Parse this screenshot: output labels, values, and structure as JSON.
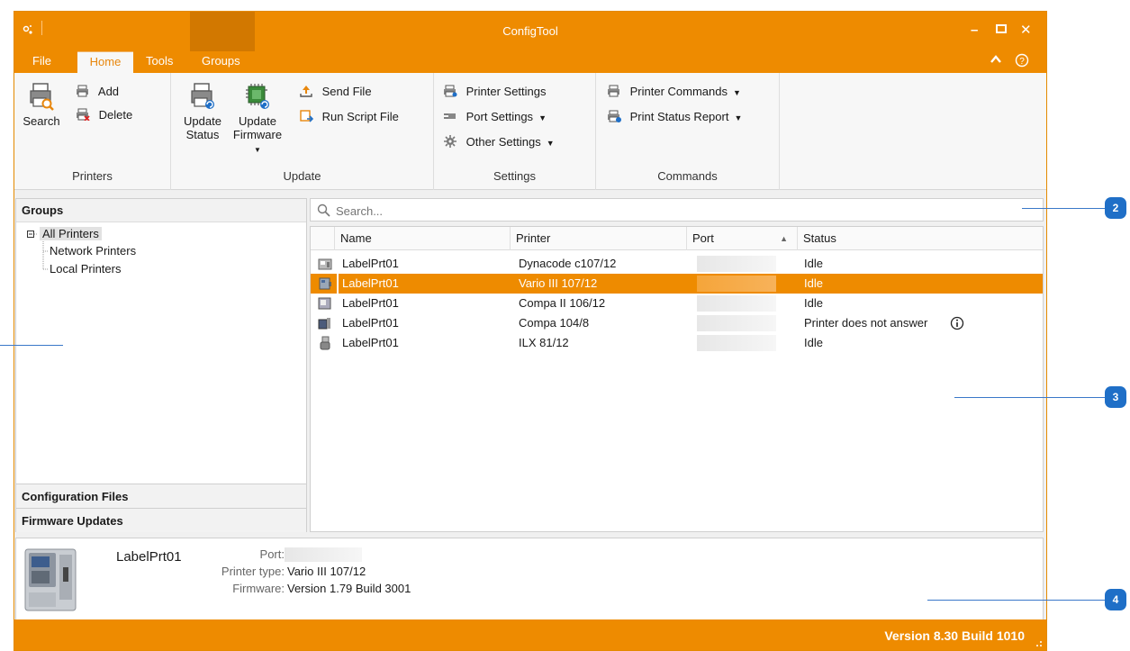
{
  "window": {
    "title": "ConfigTool",
    "minimize": "–",
    "maximize": "□",
    "close": "✕"
  },
  "menu": {
    "file": "File",
    "home": "Home",
    "tools": "Tools",
    "groups": "Groups",
    "collapse": "⌃",
    "help": "?"
  },
  "ribbon": {
    "printers": {
      "label": "Printers",
      "search": "Search",
      "add": "Add",
      "delete": "Delete"
    },
    "update": {
      "label": "Update",
      "update_status_line1": "Update",
      "update_status_line2": "Status",
      "update_firmware_line1": "Update",
      "update_firmware_line2": "Firmware",
      "send_file": "Send File",
      "run_script": "Run Script File"
    },
    "settings": {
      "label": "Settings",
      "printer_settings": "Printer Settings",
      "port_settings": "Port Settings",
      "other_settings": "Other Settings"
    },
    "commands": {
      "label": "Commands",
      "printer_commands": "Printer Commands",
      "print_status_report": "Print Status Report"
    }
  },
  "groups_panel": {
    "title": "Groups",
    "tree": {
      "root": "All Printers",
      "children": [
        "Network Printers",
        "Local Printers"
      ]
    },
    "configuration_files": "Configuration Files",
    "firmware_updates": "Firmware Updates"
  },
  "search": {
    "placeholder": "Search..."
  },
  "grid": {
    "columns": [
      "Name",
      "Printer",
      "Port",
      "Status"
    ],
    "rows": [
      {
        "name": "LabelPrt01",
        "printer": "Dynacode c107/12",
        "status": "Idle",
        "selected": false
      },
      {
        "name": "LabelPrt01",
        "printer": "Vario III 107/12",
        "status": "Idle",
        "selected": true
      },
      {
        "name": "LabelPrt01",
        "printer": "Compa II 106/12",
        "status": "Idle",
        "selected": false
      },
      {
        "name": "LabelPrt01",
        "printer": "Compa 104/8",
        "status": "Printer does not answer",
        "selected": false
      },
      {
        "name": "LabelPrt01",
        "printer": "ILX 81/12",
        "status": "Idle",
        "selected": false
      }
    ]
  },
  "details": {
    "name": "LabelPrt01",
    "port_label": "Port:",
    "printer_type_label": "Printer type:",
    "printer_type_value": "Vario III 107/12",
    "firmware_label": "Firmware:",
    "firmware_value": "Version 1.79 Build 3001"
  },
  "statusbar": {
    "version": "Version 8.30 Build 1010"
  },
  "callouts": [
    "2",
    "3",
    "4"
  ],
  "colors": {
    "accent": "#ee8b00",
    "callout": "#1f6fc7"
  }
}
